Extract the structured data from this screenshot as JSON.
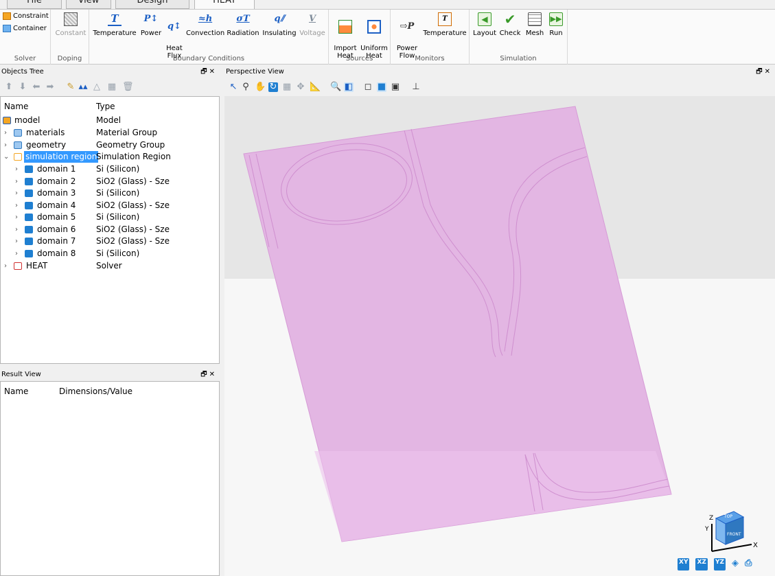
{
  "tabs": [
    "File",
    "View",
    "Design",
    "HEAT"
  ],
  "ribbon": {
    "solver": {
      "label": "Solver",
      "constraint": "Constraint",
      "container": "Container"
    },
    "doping": {
      "label": "Doping",
      "constant": "Constant"
    },
    "boundary": {
      "label": "Boundary Conditions",
      "temperature": "Temperature",
      "power": "Power",
      "heat_flux": "Heat\nFlux",
      "convection": "Convection",
      "radiation": "Radiation",
      "insulating": "Insulating",
      "voltage": "Voltage"
    },
    "sources": {
      "label": "Sources",
      "import_heat": "Import\nHeat",
      "uniform_heat": "Uniform\nHeat"
    },
    "monitors": {
      "label": "Monitors",
      "power_flow": "Power\nFlow",
      "temperature": "Temperature"
    },
    "simulation": {
      "label": "Simulation",
      "layout": "Layout",
      "check": "Check",
      "mesh": "Mesh",
      "run": "Run"
    }
  },
  "objects_tree": {
    "title": "Objects Tree",
    "columns": {
      "name": "Name",
      "type": "Type"
    },
    "rows": [
      {
        "name": "model",
        "type": "Model"
      },
      {
        "name": "materials",
        "type": "Material Group"
      },
      {
        "name": "geometry",
        "type": "Geometry Group"
      },
      {
        "name": "simulation region",
        "type": "Simulation Region"
      },
      {
        "name": "domain 1",
        "type": "Si (Silicon)"
      },
      {
        "name": "domain 2",
        "type": "SiO2 (Glass) - Sze"
      },
      {
        "name": "domain 3",
        "type": "Si (Silicon)"
      },
      {
        "name": "domain 4",
        "type": "SiO2 (Glass) - Sze"
      },
      {
        "name": "domain 5",
        "type": "Si (Silicon)"
      },
      {
        "name": "domain 6",
        "type": "SiO2 (Glass) - Sze"
      },
      {
        "name": "domain 7",
        "type": "SiO2 (Glass) - Sze"
      },
      {
        "name": "domain 8",
        "type": "Si (Silicon)"
      },
      {
        "name": "HEAT",
        "type": "Solver"
      }
    ]
  },
  "result_view": {
    "title": "Result View",
    "columns": {
      "name": "Name",
      "value": "Dimensions/Value"
    }
  },
  "perspective_view": {
    "title": "Perspective View",
    "nav_cube": {
      "top": "TOP",
      "front": "FRONT",
      "axis_x": "X",
      "axis_y": "Y",
      "axis_z": "Z"
    },
    "view_buttons": [
      "XY",
      "XZ",
      "YZ"
    ]
  },
  "colors": {
    "selection": "#3399ff",
    "geometry": "#e3b6e3",
    "viewport_bg": "#f7f7f7",
    "accent": "#1c5fc4"
  }
}
